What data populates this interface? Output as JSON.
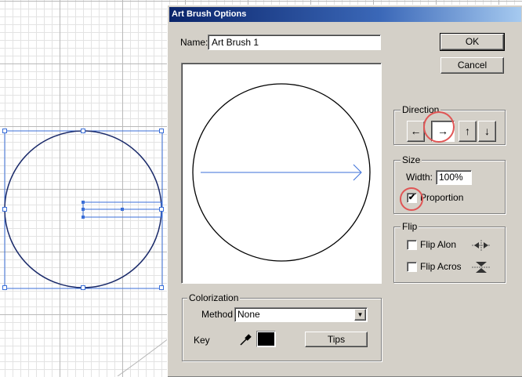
{
  "dialog": {
    "title": "Art Brush Options",
    "name_label": "Name:",
    "name_value": "Art Brush 1",
    "ok_label": "OK",
    "cancel_label": "Cancel"
  },
  "direction": {
    "title": "Direction",
    "buttons": [
      {
        "glyph": "←",
        "icon": "arrow-left-icon",
        "active": false
      },
      {
        "glyph": "→",
        "icon": "arrow-right-icon",
        "active": true
      },
      {
        "glyph": "↑",
        "icon": "arrow-up-icon",
        "active": false
      },
      {
        "glyph": "↓",
        "icon": "arrow-down-icon",
        "active": false
      }
    ]
  },
  "size": {
    "title": "Size",
    "width_label": "Width:",
    "width_value": "100%",
    "proportion_label": "Proportion",
    "proportion_checked": true,
    "proportion_mark": "✔"
  },
  "flip": {
    "title": "Flip",
    "along_label": "Flip Alon",
    "across_label": "Flip Acros"
  },
  "colorization": {
    "title": "Colorization",
    "method_label": "Method",
    "method_value": "None",
    "key_label": "Key",
    "key_color": "#000000",
    "tips_label": "Tips"
  },
  "colors": {
    "title_bar": "#0a246a",
    "panel": "#d4d0c8",
    "selection_blue": "#2f5ccc",
    "highlight_ring": "#e05555"
  }
}
